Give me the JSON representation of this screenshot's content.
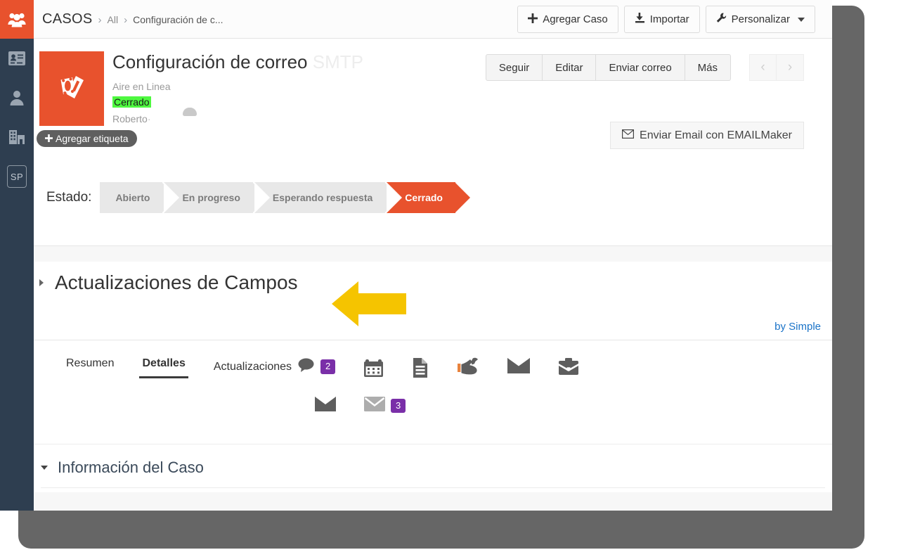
{
  "sidebar": {
    "items": [
      {
        "name": "module-cases",
        "icon": "group-people-icon",
        "active": true
      },
      {
        "name": "contacts",
        "icon": "id-card-icon",
        "active": false
      },
      {
        "name": "leads",
        "icon": "person-icon",
        "active": false
      },
      {
        "name": "accounts",
        "icon": "building-icon",
        "active": false
      },
      {
        "name": "sp-module",
        "icon": "sp-box-icon",
        "label": "SP",
        "active": false
      }
    ]
  },
  "breadcrumb": {
    "module": "CASOS",
    "sep": "›",
    "all": "All",
    "current": "Configuración de c..."
  },
  "topbar": {
    "add_label": "Agregar Caso",
    "import_label": "Importar",
    "customize_label": "Personalizar"
  },
  "record": {
    "title": "Configuración de correo",
    "title_ghost": "SMTP",
    "account": "Aire en Linea",
    "status": "Cerrado",
    "owner": "Roberto",
    "owner_tail": "·",
    "add_tag_label": "Agregar etiqueta",
    "actions": [
      "Seguir",
      "Editar",
      "Enviar correo",
      "Más"
    ],
    "prev_icon": "chevron-left-icon",
    "next_icon": "chevron-right-icon",
    "emailmaker_label": "Enviar Email con EMAILMaker"
  },
  "pipeline": {
    "label": "Estado:",
    "steps": [
      {
        "label": "Abierto",
        "active": false
      },
      {
        "label": "En progreso",
        "active": false
      },
      {
        "label": "Esperando respuesta",
        "active": false
      },
      {
        "label": "Cerrado",
        "active": true
      }
    ],
    "active_color": "#e8522d",
    "inactive_color": "#e8e8e8"
  },
  "field_updates": {
    "title": "Actualizaciones de Campos",
    "collapsed": true,
    "credit_label": "by Simple",
    "credit_color": "#1a73c8",
    "arrow_color": "#f5c400"
  },
  "tabs": {
    "row1": [
      {
        "label": "Resumen",
        "icon": "",
        "badge": "",
        "selected": false
      },
      {
        "label": "Detalles",
        "icon": "",
        "badge": "",
        "selected": true
      },
      {
        "label": "Actualizaciones",
        "icon": "comment-icon",
        "badge": "2",
        "selected": false
      },
      {
        "label": "",
        "icon": "calendar-icon",
        "badge": "",
        "selected": false
      },
      {
        "label": "",
        "icon": "document-icon",
        "badge": "",
        "selected": false
      },
      {
        "label": "",
        "icon": "service-tools-icon",
        "badge": "",
        "selected": false
      },
      {
        "label": "",
        "icon": "envelope-icon",
        "badge": "",
        "selected": false
      },
      {
        "label": "",
        "icon": "briefcase-icon",
        "badge": "",
        "selected": false
      }
    ],
    "row2": [
      {
        "label": "",
        "icon": "envelope-dark-icon",
        "badge": "",
        "selected": false
      },
      {
        "label": "",
        "icon": "envelope-light-icon",
        "badge": "3",
        "selected": false
      }
    ],
    "badge_color": "#7a2fa8"
  },
  "case_info": {
    "title": "Información del Caso",
    "expanded": true
  }
}
